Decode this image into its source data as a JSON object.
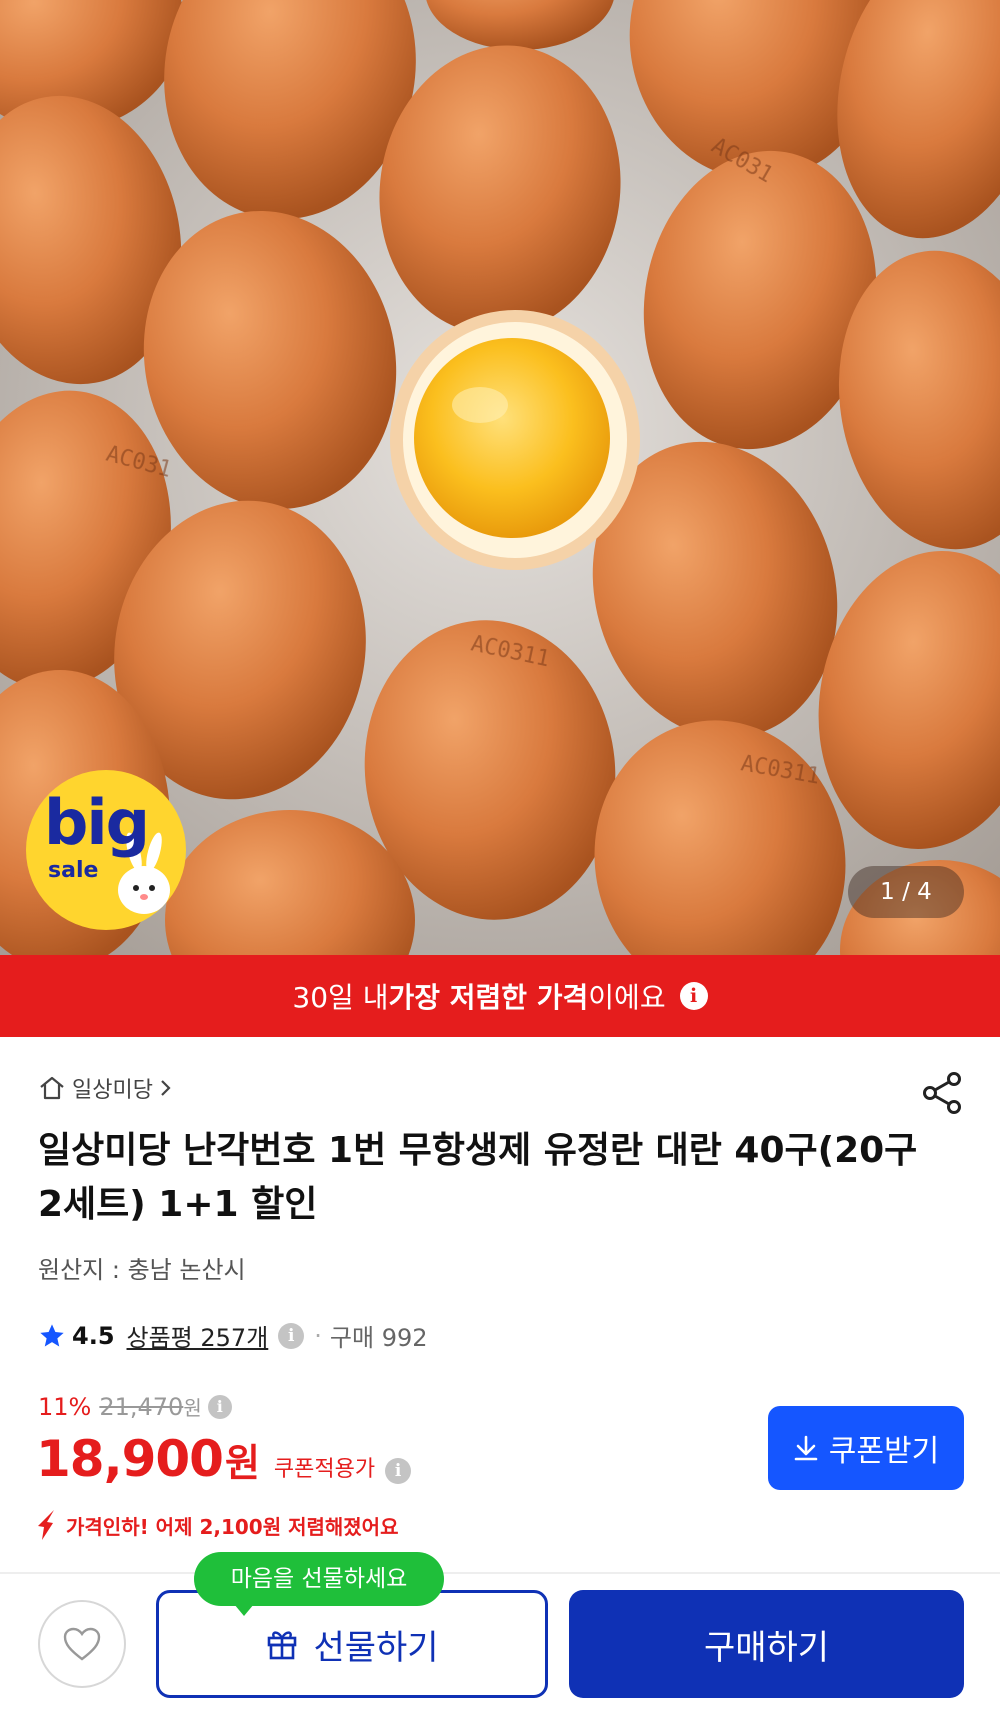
{
  "gallery": {
    "counter": "1 / 4",
    "badge": {
      "big": "big",
      "sale": "sale"
    }
  },
  "lowest_banner": {
    "pre": "30일 내 ",
    "strong": "가장 저렴한 가격",
    "post": "이에요"
  },
  "product": {
    "store": "일상미당",
    "title": "일상미당 난각번호 1번 무항생제 유정란 대란 40구(20구2세트) 1+1 할인",
    "origin": "원산지 : 충남 논산시",
    "rating": "4.5",
    "reviews": "상품평 257개",
    "purchase": "구매 992"
  },
  "pricing": {
    "discount_rate": "11%",
    "original_price": "21,470",
    "original_unit": "원",
    "price": "18,900",
    "price_unit": "원",
    "coupon_label": "쿠폰적용가",
    "coupon_button": "쿠폰받기",
    "price_drop": "가격인하! 어제 2,100원 저렴해졌어요"
  },
  "bottom_bar": {
    "gift_tooltip": "마음을 선물하세요",
    "gift_button": "선물하기",
    "buy_button": "구매하기"
  },
  "colors": {
    "accent_red": "#e51d1d",
    "brand_blue": "#0f31b5",
    "coupon_blue": "#1556ff",
    "tooltip_green": "#1fbf3a"
  }
}
